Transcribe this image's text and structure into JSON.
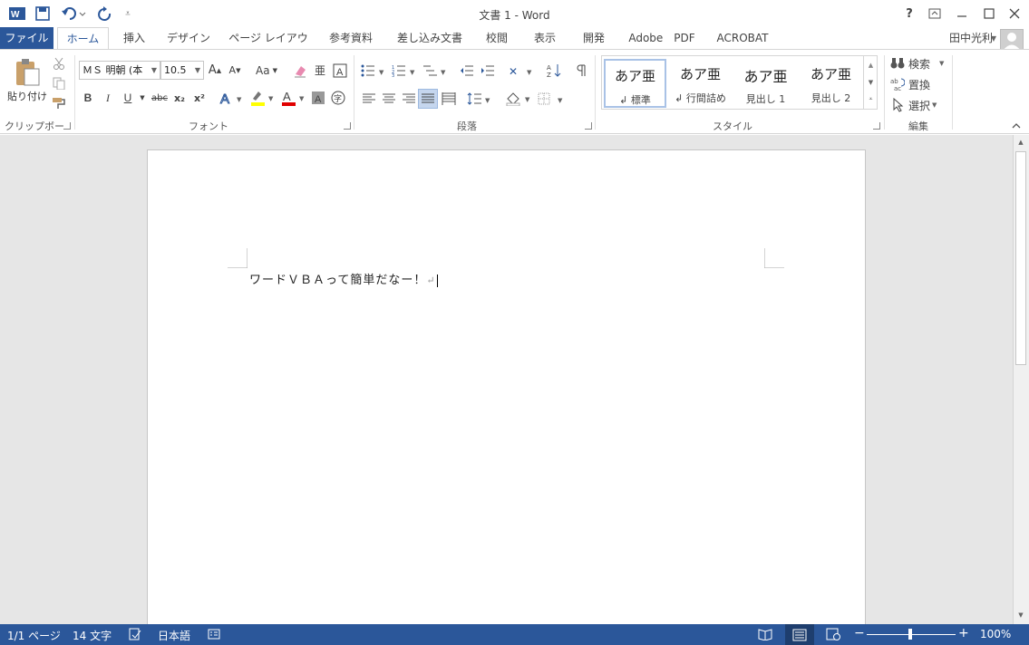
{
  "window": {
    "title": "文書 1 - Word",
    "user": "田中光利"
  },
  "tabs": [
    "ファイル",
    "ホーム",
    "挿入",
    "デザイン",
    "ページ レイアウト",
    "参考資料",
    "差し込み文書",
    "校閲",
    "表示",
    "開発",
    "Adobe　PDF",
    "ACROBAT"
  ],
  "ribbon": {
    "clipboard": {
      "paste_label": "貼り付け",
      "group": "クリップボード"
    },
    "font": {
      "font_name": "ＭＳ 明朝 (本",
      "font_size": "10.5",
      "group": "フォント",
      "bold": "B",
      "italic": "I",
      "underline": "U",
      "strike": "abc",
      "sub": "x₂",
      "sup": "x²",
      "grow": "A",
      "shrink": "A",
      "case": "Aa"
    },
    "paragraph": {
      "group": "段落"
    },
    "styles": {
      "group": "スタイル",
      "items": [
        {
          "sample": "あア亜",
          "name": "↲ 標準"
        },
        {
          "sample": "あア亜",
          "name": "↲ 行間詰め"
        },
        {
          "sample": "あア亜",
          "name": "見出し 1"
        },
        {
          "sample": "あア亜",
          "name": "見出し 2"
        }
      ]
    },
    "editing": {
      "group": "編集",
      "find": "検索",
      "replace": "置換",
      "select": "選択"
    }
  },
  "document": {
    "text": "ワードＶＢＡって簡単だなー！"
  },
  "status": {
    "page": "1/1 ページ",
    "words": "14 文字",
    "language": "日本語",
    "zoom": "100%"
  },
  "colors": {
    "accent": "#2b579a",
    "highlight": "#ffff00",
    "font_color": "#e00000"
  }
}
